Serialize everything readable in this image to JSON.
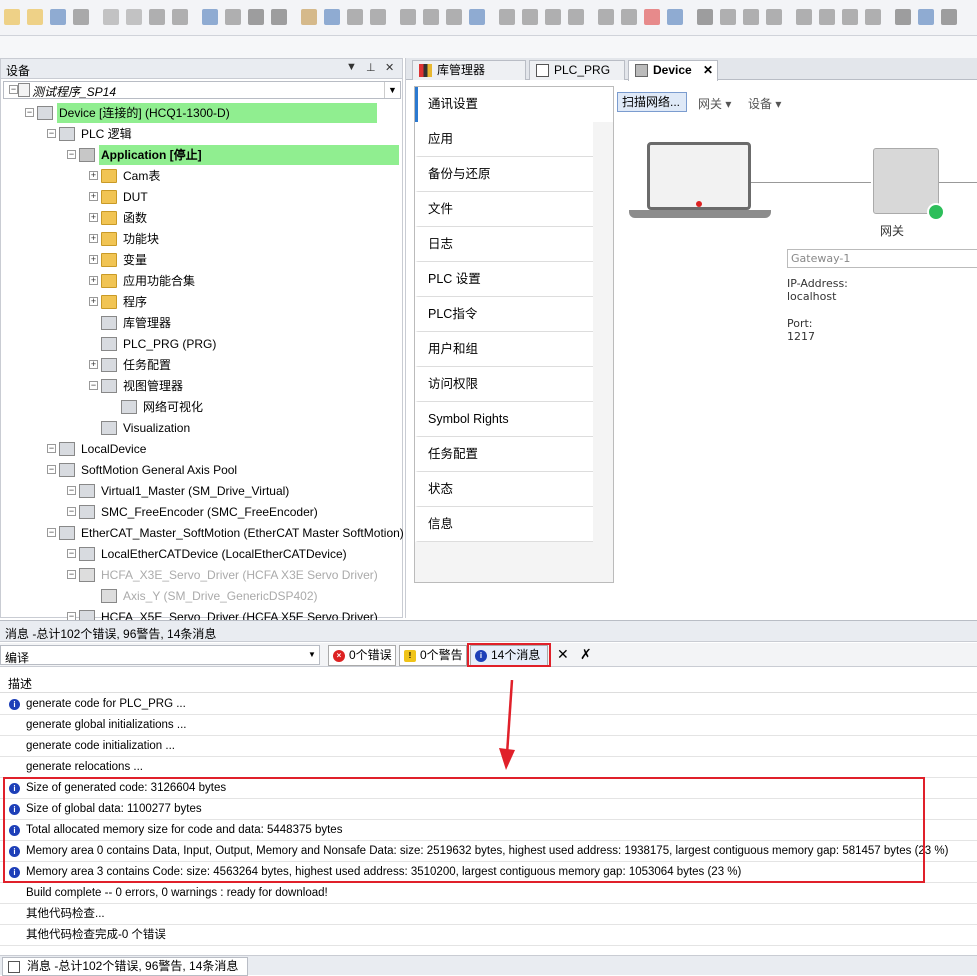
{
  "device_panel": {
    "title": "设备",
    "project": "测试程序_SP14",
    "tree": [
      {
        "label": "Device [连接的] (HCQ1-1300-D)",
        "level": 1,
        "highlight": true
      },
      {
        "label": "PLC 逻辑",
        "level": 2
      },
      {
        "label": "Application [停止]",
        "level": 3,
        "highlight": true,
        "bold": true
      },
      {
        "label": "Cam表",
        "level": 4
      },
      {
        "label": "DUT",
        "level": 4
      },
      {
        "label": "函数",
        "level": 4
      },
      {
        "label": "功能块",
        "level": 4
      },
      {
        "label": "变量",
        "level": 4
      },
      {
        "label": "应用功能合集",
        "level": 4
      },
      {
        "label": "程序",
        "level": 4
      },
      {
        "label": "库管理器",
        "level": 4
      },
      {
        "label": "PLC_PRG (PRG)",
        "level": 4
      },
      {
        "label": "任务配置",
        "level": 4
      },
      {
        "label": "视图管理器",
        "level": 4
      },
      {
        "label": "网络可视化",
        "level": 5
      },
      {
        "label": "Visualization",
        "level": 4
      },
      {
        "label": "LocalDevice",
        "level": 2
      },
      {
        "label": "SoftMotion General Axis Pool",
        "level": 2
      },
      {
        "label": "Virtual1_Master (SM_Drive_Virtual)",
        "level": 3
      },
      {
        "label": "SMC_FreeEncoder (SMC_FreeEncoder)",
        "level": 3
      },
      {
        "label": "EtherCAT_Master_SoftMotion (EtherCAT Master SoftMotion)",
        "level": 2
      },
      {
        "label": "LocalEtherCATDevice (LocalEtherCATDevice)",
        "level": 3
      },
      {
        "label": "HCFA_X3E_Servo_Driver (HCFA X3E Servo Driver)",
        "level": 3,
        "gray": true
      },
      {
        "label": "Axis_Y (SM_Drive_GenericDSP402)",
        "level": 4,
        "gray": true
      },
      {
        "label": "HCFA_X5E_Servo_Driver (HCFA X5E Servo Driver)",
        "level": 3
      }
    ]
  },
  "editor": {
    "tabs": [
      "库管理器",
      "PLC_PRG",
      "Device"
    ],
    "nav": [
      "通讯设置",
      "应用",
      "备份与还原",
      "文件",
      "日志",
      "PLC 设置",
      "PLC指令",
      "用户和组",
      "访问权限",
      "Symbol Rights",
      "任务配置",
      "状态",
      "信息"
    ],
    "scan_button": "扫描网络...",
    "gateway_menu": "网关",
    "device_menu": "设备",
    "gateway_label": "网关",
    "gateway_name": "Gateway-1",
    "ip_label": "IP-Address:",
    "ip_value": "localhost",
    "port_label": "Port:",
    "port_value": "1217"
  },
  "messages": {
    "title": "消息 -总计102个错误, 96警告, 14条消息",
    "filter": "编译",
    "errors_btn": "0个错误",
    "warnings_btn": "0个警告",
    "messages_btn": "14个消息",
    "desc_header": "描述",
    "rows": [
      {
        "text": "generate code for PLC_PRG ...",
        "info": true
      },
      {
        "text": "generate global initializations ...",
        "info": false
      },
      {
        "text": "generate code initialization ...",
        "info": false
      },
      {
        "text": "generate relocations ...",
        "info": false
      },
      {
        "text": "Size of generated code: 3126604 bytes",
        "info": true
      },
      {
        "text": "Size of global data: 1100277 bytes",
        "info": true
      },
      {
        "text": "Total allocated memory size for code and data: 5448375 bytes",
        "info": true
      },
      {
        "text": "Memory area 0 contains  Data, Input, Output, Memory and Nonsafe Data: size: 2519632 bytes, highest used address: 1938175, largest contiguous memory gap: 581457 bytes (23 %)",
        "info": true
      },
      {
        "text": "Memory area 3 contains  Code: size: 4563264 bytes, highest used address: 3510200, largest contiguous memory gap: 1053064 bytes (23 %)",
        "info": true
      },
      {
        "text": "Build complete -- 0 errors, 0 warnings : ready for download!",
        "info": false
      },
      {
        "text": "其他代码检查...",
        "info": false
      },
      {
        "text": "其他代码检查完成-0 个错误",
        "info": false
      }
    ]
  },
  "status_bar": {
    "tab": "消息 -总计102个错误, 96警告, 14条消息"
  },
  "colors": {
    "highlight": "#90ee90",
    "accent": "#2b79d0",
    "callout": "#e0202a",
    "info": "#1d3fb8"
  }
}
